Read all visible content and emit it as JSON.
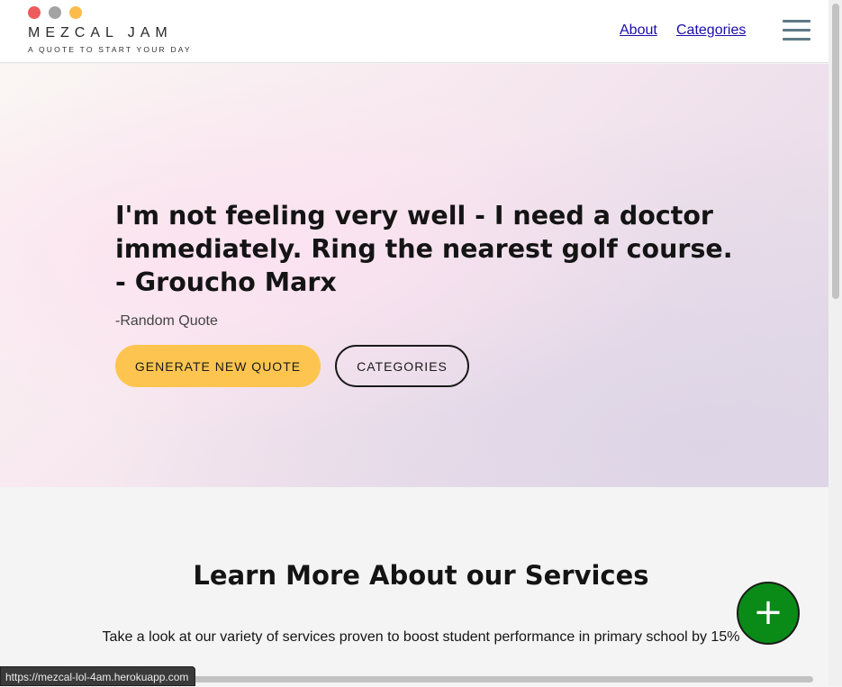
{
  "header": {
    "logo_name": "MEZCAL JAM",
    "logo_tagline": "A QUOTE TO START YOUR DAY",
    "logo_dot_colors": [
      "#ef5b5b",
      "#a3a3a3",
      "#fbbc4a"
    ],
    "nav": {
      "about": "About",
      "categories": "Categories"
    },
    "menu_icon": "hamburger-menu-icon"
  },
  "hero": {
    "quote": "I'm not feeling very well - I need a doctor immediately. Ring the nearest golf course. - Groucho Marx",
    "source": "-Random Quote",
    "generate_button": "GENERATE NEW QUOTE",
    "categories_button": "CATEGORIES",
    "accent_color": "#fdc54f"
  },
  "services": {
    "title": "Learn More About our Services",
    "text": "Take a look at our variety of services proven to boost student performance in primary school by 15%"
  },
  "fab": {
    "label": "+",
    "color": "#0a8a16"
  },
  "status_bar": {
    "url": "https://mezcal-lol-4am.herokuapp.com"
  }
}
